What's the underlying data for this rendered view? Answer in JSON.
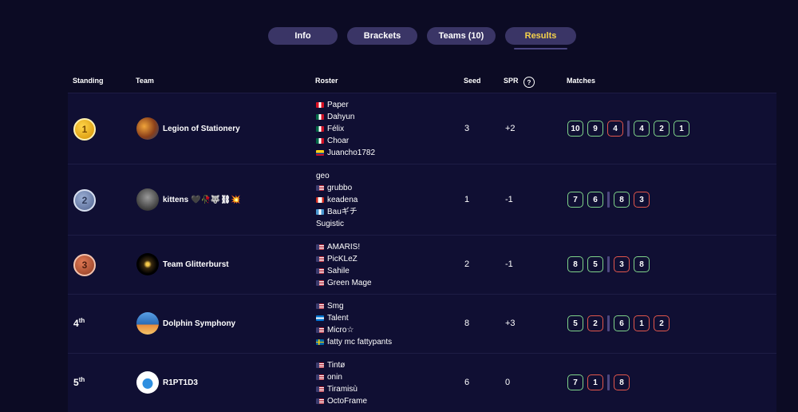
{
  "tabs": [
    {
      "label": "Info",
      "active": false
    },
    {
      "label": "Brackets",
      "active": false
    },
    {
      "label": "Teams (10)",
      "active": false
    },
    {
      "label": "Results",
      "active": true
    }
  ],
  "colors": {
    "background": "#0c0b24",
    "row_background": "#100f33",
    "tab_background": "#3a3566",
    "active_tab_text": "#f5d24a",
    "match_win": "#7fd38a",
    "match_loss": "#e2574c"
  },
  "columns": {
    "standing": "Standing",
    "team": "Team",
    "roster": "Roster",
    "seed": "Seed",
    "spr": "SPR",
    "spr_help": "?",
    "matches": "Matches"
  },
  "rows": [
    {
      "standing": "1",
      "medal": "gold",
      "team": "Legion of Stationery",
      "roster": [
        {
          "name": "Paper",
          "flag": "peru-flag"
        },
        {
          "name": "Dahyun",
          "flag": "mexico-flag"
        },
        {
          "name": "Félix",
          "flag": "mexico-flag"
        },
        {
          "name": "Choar",
          "flag": "mexico-flag"
        },
        {
          "name": "Juancho1782",
          "flag": "colombia-flag"
        }
      ],
      "seed": "3",
      "spr": "+2",
      "matches": [
        [
          "10",
          "9",
          "4"
        ],
        [
          "4",
          "2",
          "1"
        ]
      ],
      "results": [
        [
          "win",
          "win",
          "loss"
        ],
        [
          "win",
          "win",
          "win"
        ]
      ]
    },
    {
      "standing": "2",
      "medal": "silver",
      "team": "kittens 🖤🥀🐺⛓💥",
      "roster": [
        {
          "name": "geo",
          "flag": ""
        },
        {
          "name": "grubbo",
          "flag": "usa-flag"
        },
        {
          "name": "keadena",
          "flag": "canada-flag"
        },
        {
          "name": "Bauギチ",
          "flag": "guatemala-flag"
        },
        {
          "name": "Sugistic",
          "flag": ""
        }
      ],
      "seed": "1",
      "spr": "-1",
      "matches": [
        [
          "7",
          "6"
        ],
        [
          "8",
          "3"
        ]
      ],
      "results": [
        [
          "win",
          "win"
        ],
        [
          "win",
          "loss"
        ]
      ]
    },
    {
      "standing": "3",
      "medal": "bronze",
      "team": "Team Glitterburst",
      "roster": [
        {
          "name": "AMARIS!",
          "flag": "usa-flag"
        },
        {
          "name": "PicKLeZ",
          "flag": "usa-flag"
        },
        {
          "name": "Sahile",
          "flag": "usa-flag"
        },
        {
          "name": "Green Mage",
          "flag": "usa-flag"
        }
      ],
      "seed": "2",
      "spr": "-1",
      "matches": [
        [
          "8",
          "5"
        ],
        [
          "3",
          "8"
        ]
      ],
      "results": [
        [
          "win",
          "win"
        ],
        [
          "loss",
          "win"
        ]
      ]
    },
    {
      "standing": "4",
      "suffix": "th",
      "team": "Dolphin Symphony",
      "roster": [
        {
          "name": "Smg",
          "flag": "usa-flag"
        },
        {
          "name": "Talent",
          "flag": "honduras-flag"
        },
        {
          "name": "Micro☆",
          "flag": "usa-flag"
        },
        {
          "name": "fatty mc fattypants",
          "flag": "sweden-flag"
        }
      ],
      "seed": "8",
      "spr": "+3",
      "matches": [
        [
          "5",
          "2"
        ],
        [
          "6",
          "1",
          "2"
        ]
      ],
      "results": [
        [
          "win",
          "loss"
        ],
        [
          "win",
          "loss",
          "loss"
        ]
      ]
    },
    {
      "standing": "5",
      "suffix": "th",
      "team": "R1PT1D3",
      "roster": [
        {
          "name": "Tintø",
          "flag": "usa-flag"
        },
        {
          "name": "onin",
          "flag": "usa-flag"
        },
        {
          "name": "Tiramisù",
          "flag": "usa-flag"
        },
        {
          "name": "OctoFrame",
          "flag": "usa-flag"
        }
      ],
      "seed": "6",
      "spr": "0",
      "matches": [
        [
          "7",
          "1"
        ],
        [
          "8"
        ]
      ],
      "results": [
        [
          "win",
          "loss"
        ],
        [
          "loss"
        ]
      ]
    }
  ]
}
